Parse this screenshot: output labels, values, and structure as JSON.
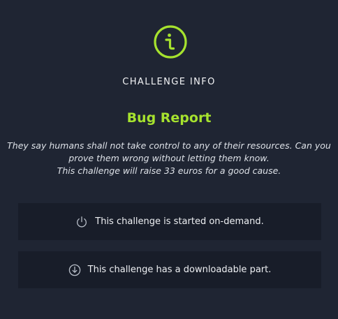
{
  "header": {
    "icon": "info-circle-icon",
    "section_label": "CHALLENGE INFO",
    "accent_color": "#a6e22e"
  },
  "challenge": {
    "title": "Bug Report",
    "description_lines": [
      "They say humans shall not take control to any of their resources. Can you",
      "prove them wrong without letting them know.",
      "This challenge will raise 33 euros for a good cause."
    ]
  },
  "cards": [
    {
      "icon": "power-icon",
      "text": "This challenge is started on-demand."
    },
    {
      "icon": "download-circle-icon",
      "text": "This challenge has a downloadable part."
    }
  ]
}
